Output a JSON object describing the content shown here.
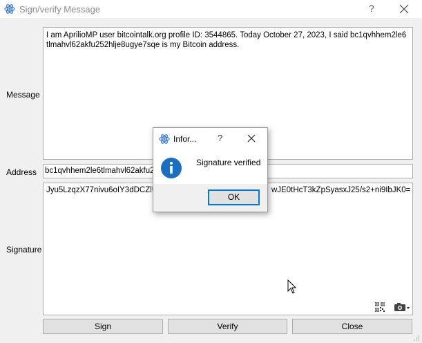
{
  "window": {
    "title": "Sign/verify Message",
    "help_label": "?"
  },
  "form": {
    "message_label": "Message",
    "message_text": "I am AprilioMP user bitcointalk.org profile ID: 3544865. Today October 27, 2023, I said bc1qvhhem2le6tlmahvl62akfu252hlje8ugye7sqe is my Bitcoin address.",
    "address_label": "Address",
    "address_value": "bc1qvhhem2le6tlmahvl62akfu252",
    "signature_label": "Signature",
    "signature_text_left": "Jyu5LzqzX77nivu6oIY3dDCZlUwl",
    "signature_text_right": "wJE0tHcT3kZpSyasxJ25/s2+ni9IbJK0="
  },
  "buttons": {
    "sign": "Sign",
    "verify": "Verify",
    "close": "Close"
  },
  "dialog": {
    "title": "Infor...",
    "help_label": "?",
    "message": "Signature verified",
    "ok": "OK"
  },
  "colors": {
    "accent_blue": "#0078d7",
    "info_icon_blue": "#1a6fc0",
    "app_icon_blue": "#3a7bd5"
  }
}
